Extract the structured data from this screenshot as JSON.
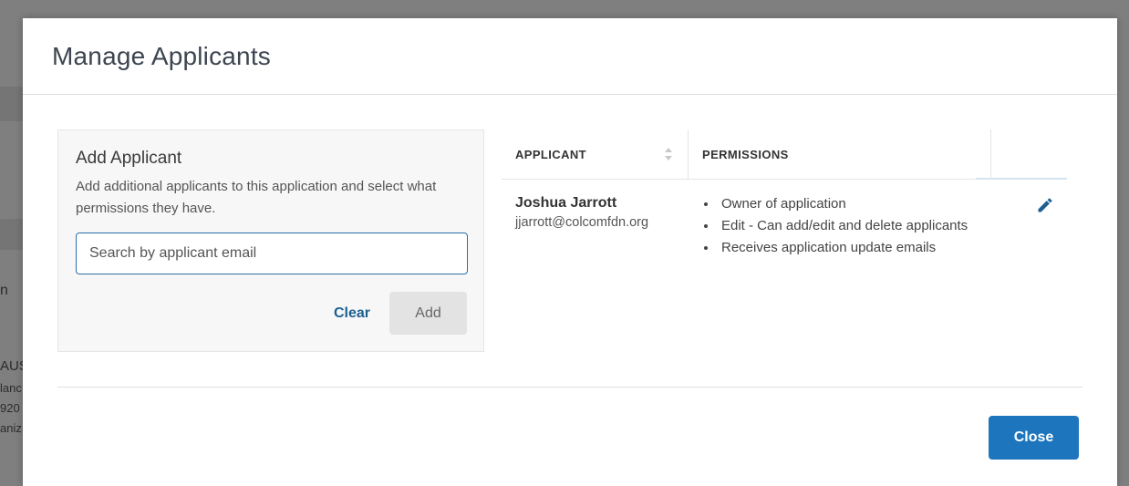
{
  "background": {
    "fragments": [
      "n",
      "AUS",
      "lanc",
      "920",
      "aniz"
    ]
  },
  "modal": {
    "title": "Manage Applicants"
  },
  "add_applicant": {
    "title": "Add Applicant",
    "description": "Add additional applicants to this application and select what permissions they have.",
    "search_placeholder": "Search by applicant email",
    "search_value": "",
    "clear_label": "Clear",
    "add_label": "Add"
  },
  "table": {
    "headers": {
      "applicant": "APPLICANT",
      "permissions": "PERMISSIONS"
    },
    "rows": [
      {
        "name": "Joshua Jarrott",
        "email": "jjarrott@colcomfdn.org",
        "permissions": [
          "Owner of application",
          "Edit - Can add/edit and delete applicants",
          "Receives application update emails"
        ],
        "action_icon": "pencil-icon"
      }
    ]
  },
  "footer": {
    "close_label": "Close"
  },
  "colors": {
    "overlay": "#7f7f7f",
    "primary": "#1c75bd",
    "link": "#1d5f91",
    "input_border": "#2a6fa8"
  }
}
